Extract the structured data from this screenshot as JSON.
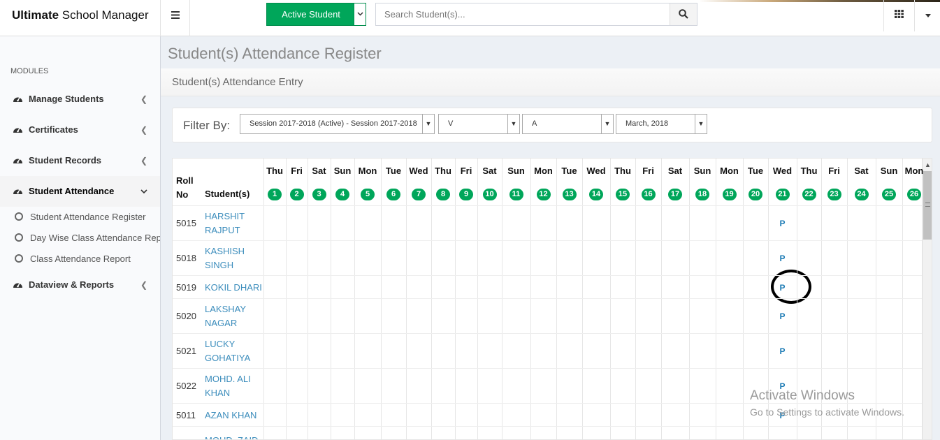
{
  "app": {
    "brand_bold": "Ultimate",
    "brand_rest": " School Manager"
  },
  "header": {
    "menu_icon": "hamburger-icon",
    "active_student_label": "Active Student",
    "search_placeholder": "Search Student(s)...",
    "search_icon": "search-icon",
    "apps_icon": "grid-icon",
    "user_caret_icon": "caret-down-icon"
  },
  "sidebar": {
    "modules_header": "MODULES",
    "items": [
      {
        "label": "Manage Students",
        "icon": "dashboard-icon"
      },
      {
        "label": "Certificates",
        "icon": "dashboard-icon"
      },
      {
        "label": "Student Records",
        "icon": "dashboard-icon"
      },
      {
        "label": "Student Attendance",
        "icon": "dashboard-icon"
      },
      {
        "label": "Dataview & Reports",
        "icon": "dashboard-icon"
      }
    ],
    "subitems": [
      "Student Attendance Register",
      "Day Wise Class Attendance Report",
      "Class Attendance Report"
    ]
  },
  "page": {
    "title": "Student(s) Attendance Register",
    "breadcrumb": "Student(s) Attendance Entry"
  },
  "filter": {
    "label": "Filter By:",
    "session": "Session 2017-2018 (Active) - Session 2017-2018",
    "class": "V",
    "section": "A",
    "month": "March, 2018"
  },
  "table": {
    "roll_header_1": "Roll",
    "roll_header_2": "No",
    "student_header": "Student(s)",
    "days": [
      {
        "d": "Thu",
        "n": "1"
      },
      {
        "d": "Fri",
        "n": "2"
      },
      {
        "d": "Sat",
        "n": "3"
      },
      {
        "d": "Sun",
        "n": "4"
      },
      {
        "d": "Mon",
        "n": "5"
      },
      {
        "d": "Tue",
        "n": "6"
      },
      {
        "d": "Wed",
        "n": "7"
      },
      {
        "d": "Thu",
        "n": "8"
      },
      {
        "d": "Fri",
        "n": "9"
      },
      {
        "d": "Sat",
        "n": "10"
      },
      {
        "d": "Sun",
        "n": "11"
      },
      {
        "d": "Mon",
        "n": "12"
      },
      {
        "d": "Tue",
        "n": "13"
      },
      {
        "d": "Wed",
        "n": "14"
      },
      {
        "d": "Thu",
        "n": "15"
      },
      {
        "d": "Fri",
        "n": "16"
      },
      {
        "d": "Sat",
        "n": "17"
      },
      {
        "d": "Sun",
        "n": "18"
      },
      {
        "d": "Mon",
        "n": "19"
      },
      {
        "d": "Tue",
        "n": "20"
      },
      {
        "d": "Wed",
        "n": "21"
      },
      {
        "d": "Thu",
        "n": "22"
      },
      {
        "d": "Fri",
        "n": "23"
      },
      {
        "d": "Sat",
        "n": "24"
      },
      {
        "d": "Sun",
        "n": "25"
      },
      {
        "d": "Mon",
        "n": "26"
      }
    ],
    "students": [
      {
        "roll": "5015",
        "name": "HARSHIT RAJPUT",
        "mark": "P"
      },
      {
        "roll": "5018",
        "name": "KASHISH SINGH",
        "mark": "P"
      },
      {
        "roll": "5019",
        "name": "KOKIL DHARI",
        "mark": "P"
      },
      {
        "roll": "5020",
        "name": "LAKSHAY NAGAR",
        "mark": "P"
      },
      {
        "roll": "5021",
        "name": "LUCKY GOHATIYA",
        "mark": "P"
      },
      {
        "roll": "5022",
        "name": "MOHD. ALI KHAN",
        "mark": "P"
      },
      {
        "roll": "5011",
        "name": "AZAN KHAN",
        "mark": "P"
      },
      {
        "roll": "",
        "name": "MOHD. ZAID",
        "mark": ""
      }
    ]
  },
  "watermark": {
    "line1": "Activate Windows",
    "line2": "Go to Settings to activate Windows."
  }
}
